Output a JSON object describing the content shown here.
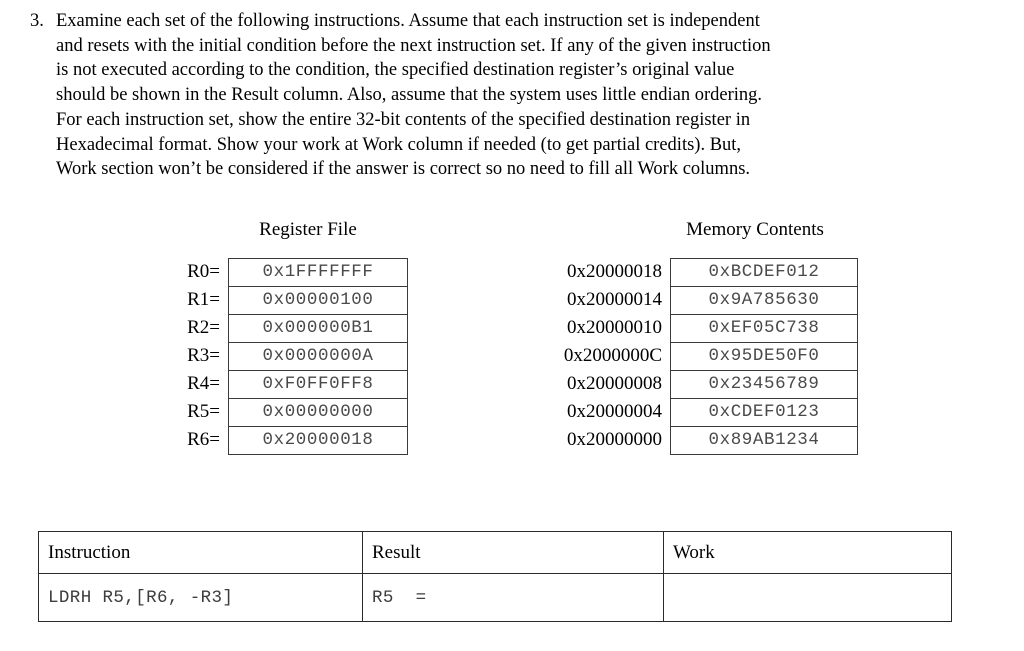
{
  "question": {
    "number": "3.",
    "lines": [
      "Examine each set of the following instructions. Assume that each instruction set is independent",
      "and resets with the initial condition before the next instruction set. If any of the given instruction",
      "is not executed according to the condition, the specified destination register’s original value",
      "should be shown in the Result column. Also, assume that the system uses little endian ordering.",
      "For each instruction set, show the entire 32-bit contents of the specified destination register in",
      "Hexadecimal format. Show your work at Work column if needed (to get partial credits). But,",
      "Work section won’t be considered if the answer is correct so no need to fill all Work columns."
    ]
  },
  "register_file": {
    "title": "Register File",
    "rows": [
      {
        "label": "R0=",
        "value": "0x1FFFFFFF"
      },
      {
        "label": "R1=",
        "value": "0x00000100"
      },
      {
        "label": "R2=",
        "value": "0x000000B1"
      },
      {
        "label": "R3=",
        "value": "0x0000000A"
      },
      {
        "label": "R4=",
        "value": "0xF0FF0FF8"
      },
      {
        "label": "R5=",
        "value": "0x00000000"
      },
      {
        "label": "R6=",
        "value": "0x20000018"
      }
    ]
  },
  "memory_contents": {
    "title": "Memory Contents",
    "rows": [
      {
        "label": "0x20000018",
        "value": "0xBCDEF012"
      },
      {
        "label": "0x20000014",
        "value": "0x9A785630"
      },
      {
        "label": "0x20000010",
        "value": "0xEF05C738"
      },
      {
        "label": "0x2000000C",
        "value": "0x95DE50F0"
      },
      {
        "label": "0x20000008",
        "value": "0x23456789"
      },
      {
        "label": "0x20000004",
        "value": "0xCDEF0123"
      },
      {
        "label": "0x20000000",
        "value": "0x89AB1234"
      }
    ]
  },
  "worksheet": {
    "headers": {
      "instruction": "Instruction",
      "result": "Result",
      "work": "Work"
    },
    "rows": [
      {
        "instruction": "LDRH R5,[R6, -R3]",
        "result": "R5  =",
        "work": ""
      }
    ]
  }
}
